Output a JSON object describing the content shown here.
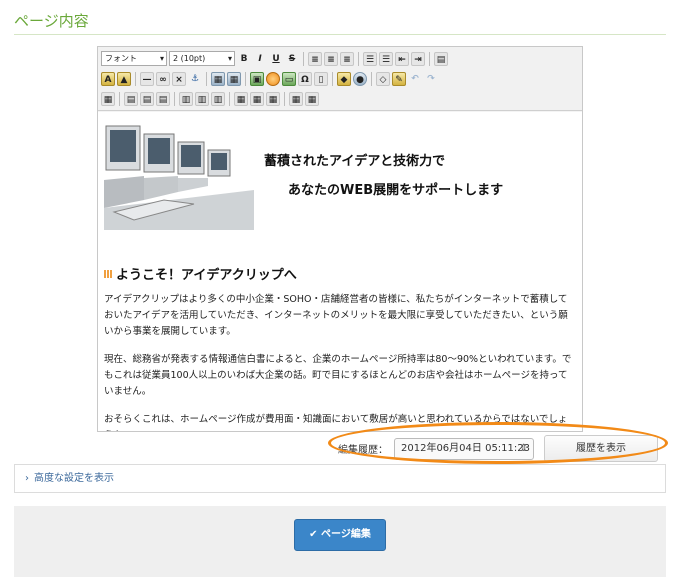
{
  "section": {
    "title": "ページ内容"
  },
  "toolbar": {
    "font_select": "フォント",
    "size_select": "2 (10pt)",
    "bold": "B",
    "italic": "I",
    "underline": "U",
    "strike": "S"
  },
  "content": {
    "slogan_line1": "蓄積されたアイデアと技術力で",
    "slogan_line2": "あなたのWEB展開をサポートします",
    "welcome_heading": "ようこそ！アイデアクリップへ",
    "paragraph1": "アイデアクリップはより多くの中小企業・SOHO・店舗経営者の皆様に、私たちがインターネットで蓄積しておいたアイデアを活用していただき、インターネットのメリットを最大限に享受していただきたい、という願いから事業を展開しています。",
    "paragraph2": "現在、総務省が発表する情報通信白書によると、企業のホームページ所持率は80〜90%といわれています。でもこれは従業員100人以上のいわば大企業の話。町で目にするほとんどのお店や会社はホームページを持っていません。",
    "paragraph3": "おそらくこれは、ホームページ作成が費用面・知識面において敷居が高いと思われているからではないでしょうか。"
  },
  "history": {
    "label": "編集履歴：",
    "selected": "2012年06月04日 05:11:23",
    "show_button": "履歴を表示"
  },
  "advanced": {
    "label": "高度な設定を表示"
  },
  "actions": {
    "edit_button": "ページ編集"
  },
  "colors": {
    "accent_green": "#6aa83a",
    "primary_blue": "#3b86c9",
    "highlight_orange": "#f28a17"
  }
}
